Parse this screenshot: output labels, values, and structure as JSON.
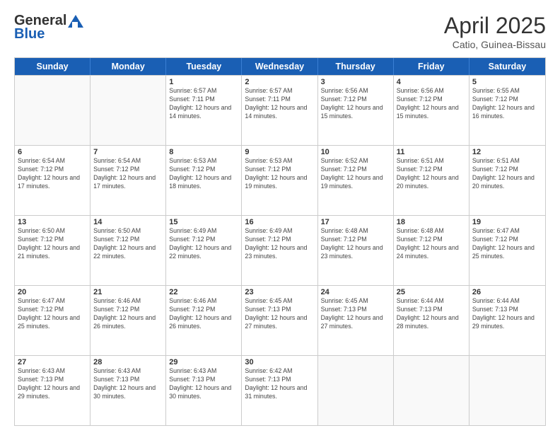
{
  "logo": {
    "general": "General",
    "blue": "Blue"
  },
  "title": "April 2025",
  "subtitle": "Catio, Guinea-Bissau",
  "days": [
    "Sunday",
    "Monday",
    "Tuesday",
    "Wednesday",
    "Thursday",
    "Friday",
    "Saturday"
  ],
  "weeks": [
    [
      {
        "day": "",
        "info": ""
      },
      {
        "day": "",
        "info": ""
      },
      {
        "day": "1",
        "info": "Sunrise: 6:57 AM\nSunset: 7:11 PM\nDaylight: 12 hours and 14 minutes."
      },
      {
        "day": "2",
        "info": "Sunrise: 6:57 AM\nSunset: 7:11 PM\nDaylight: 12 hours and 14 minutes."
      },
      {
        "day": "3",
        "info": "Sunrise: 6:56 AM\nSunset: 7:12 PM\nDaylight: 12 hours and 15 minutes."
      },
      {
        "day": "4",
        "info": "Sunrise: 6:56 AM\nSunset: 7:12 PM\nDaylight: 12 hours and 15 minutes."
      },
      {
        "day": "5",
        "info": "Sunrise: 6:55 AM\nSunset: 7:12 PM\nDaylight: 12 hours and 16 minutes."
      }
    ],
    [
      {
        "day": "6",
        "info": "Sunrise: 6:54 AM\nSunset: 7:12 PM\nDaylight: 12 hours and 17 minutes."
      },
      {
        "day": "7",
        "info": "Sunrise: 6:54 AM\nSunset: 7:12 PM\nDaylight: 12 hours and 17 minutes."
      },
      {
        "day": "8",
        "info": "Sunrise: 6:53 AM\nSunset: 7:12 PM\nDaylight: 12 hours and 18 minutes."
      },
      {
        "day": "9",
        "info": "Sunrise: 6:53 AM\nSunset: 7:12 PM\nDaylight: 12 hours and 19 minutes."
      },
      {
        "day": "10",
        "info": "Sunrise: 6:52 AM\nSunset: 7:12 PM\nDaylight: 12 hours and 19 minutes."
      },
      {
        "day": "11",
        "info": "Sunrise: 6:51 AM\nSunset: 7:12 PM\nDaylight: 12 hours and 20 minutes."
      },
      {
        "day": "12",
        "info": "Sunrise: 6:51 AM\nSunset: 7:12 PM\nDaylight: 12 hours and 20 minutes."
      }
    ],
    [
      {
        "day": "13",
        "info": "Sunrise: 6:50 AM\nSunset: 7:12 PM\nDaylight: 12 hours and 21 minutes."
      },
      {
        "day": "14",
        "info": "Sunrise: 6:50 AM\nSunset: 7:12 PM\nDaylight: 12 hours and 22 minutes."
      },
      {
        "day": "15",
        "info": "Sunrise: 6:49 AM\nSunset: 7:12 PM\nDaylight: 12 hours and 22 minutes."
      },
      {
        "day": "16",
        "info": "Sunrise: 6:49 AM\nSunset: 7:12 PM\nDaylight: 12 hours and 23 minutes."
      },
      {
        "day": "17",
        "info": "Sunrise: 6:48 AM\nSunset: 7:12 PM\nDaylight: 12 hours and 23 minutes."
      },
      {
        "day": "18",
        "info": "Sunrise: 6:48 AM\nSunset: 7:12 PM\nDaylight: 12 hours and 24 minutes."
      },
      {
        "day": "19",
        "info": "Sunrise: 6:47 AM\nSunset: 7:12 PM\nDaylight: 12 hours and 25 minutes."
      }
    ],
    [
      {
        "day": "20",
        "info": "Sunrise: 6:47 AM\nSunset: 7:12 PM\nDaylight: 12 hours and 25 minutes."
      },
      {
        "day": "21",
        "info": "Sunrise: 6:46 AM\nSunset: 7:12 PM\nDaylight: 12 hours and 26 minutes."
      },
      {
        "day": "22",
        "info": "Sunrise: 6:46 AM\nSunset: 7:12 PM\nDaylight: 12 hours and 26 minutes."
      },
      {
        "day": "23",
        "info": "Sunrise: 6:45 AM\nSunset: 7:13 PM\nDaylight: 12 hours and 27 minutes."
      },
      {
        "day": "24",
        "info": "Sunrise: 6:45 AM\nSunset: 7:13 PM\nDaylight: 12 hours and 27 minutes."
      },
      {
        "day": "25",
        "info": "Sunrise: 6:44 AM\nSunset: 7:13 PM\nDaylight: 12 hours and 28 minutes."
      },
      {
        "day": "26",
        "info": "Sunrise: 6:44 AM\nSunset: 7:13 PM\nDaylight: 12 hours and 29 minutes."
      }
    ],
    [
      {
        "day": "27",
        "info": "Sunrise: 6:43 AM\nSunset: 7:13 PM\nDaylight: 12 hours and 29 minutes."
      },
      {
        "day": "28",
        "info": "Sunrise: 6:43 AM\nSunset: 7:13 PM\nDaylight: 12 hours and 30 minutes."
      },
      {
        "day": "29",
        "info": "Sunrise: 6:43 AM\nSunset: 7:13 PM\nDaylight: 12 hours and 30 minutes."
      },
      {
        "day": "30",
        "info": "Sunrise: 6:42 AM\nSunset: 7:13 PM\nDaylight: 12 hours and 31 minutes."
      },
      {
        "day": "",
        "info": ""
      },
      {
        "day": "",
        "info": ""
      },
      {
        "day": "",
        "info": ""
      }
    ]
  ]
}
